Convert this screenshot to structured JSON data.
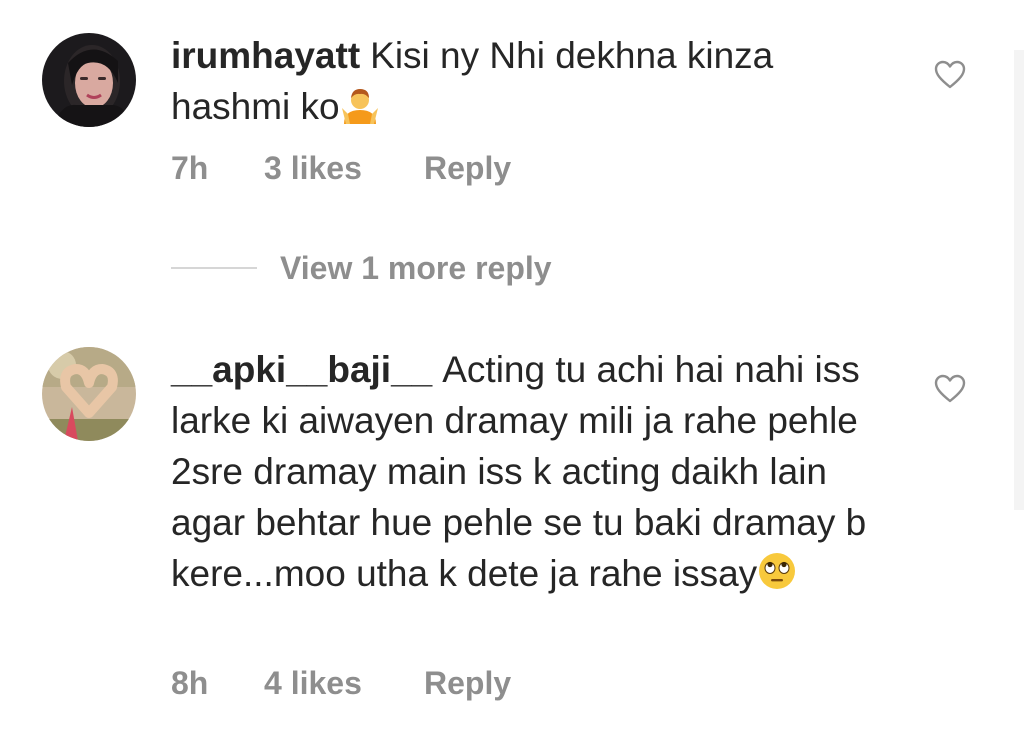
{
  "comments": [
    {
      "username": "irumhayatt",
      "text": "Kisi ny Nhi dekhna kinza hashmi ko",
      "emoji": "person-shrugging-emoji",
      "time": "7h",
      "likes": "3 likes",
      "reply_label": "Reply",
      "avatar": "user-avatar-photo"
    },
    {
      "username": "__apki__baji__",
      "text": "Acting tu achi hai nahi iss larke ki aiwayen dramay mili ja rahe pehle 2sre dramay main iss k acting daikh lain agar behtar hue pehle se tu baki dramay b kere...moo utha k dete ja rahe issay",
      "emoji": "face-with-rolling-eyes-emoji",
      "time": "8h",
      "likes": "4 likes",
      "reply_label": "Reply",
      "avatar": "heart-hands-avatar-photo"
    }
  ],
  "view_replies": {
    "label": "View 1 more reply"
  },
  "icons": {
    "like": "heart-outline-icon"
  },
  "colors": {
    "primary_text": "#262626",
    "secondary_text": "#8e8e8e",
    "divider": "#d6d6d6"
  }
}
